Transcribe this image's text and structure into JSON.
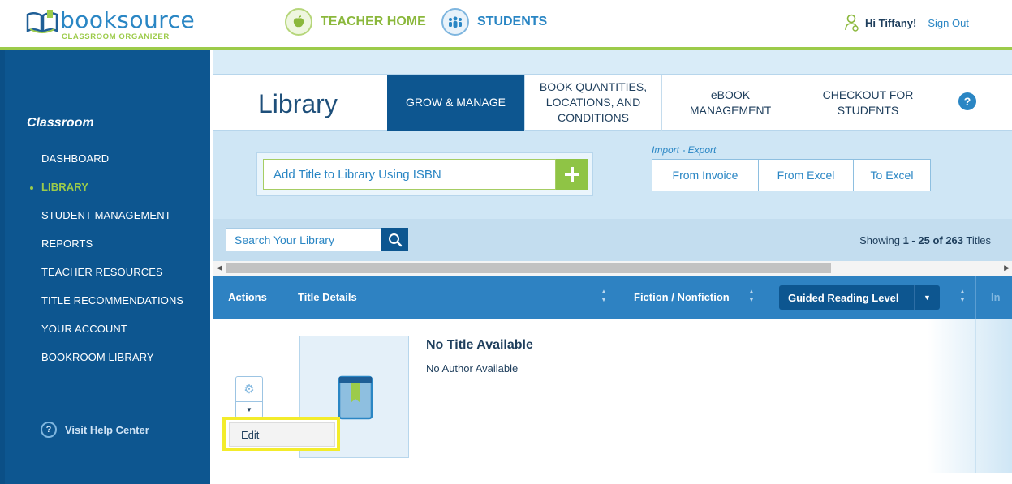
{
  "brand": {
    "name": "booksource",
    "tagline": "CLASSROOM ORGANIZER",
    "primary_color": "#2a86c4",
    "accent_color": "#9ccb4a",
    "sidebar_color": "#0d5690"
  },
  "header": {
    "nav": [
      {
        "label": "TEACHER HOME",
        "icon": "apple-icon",
        "active": true
      },
      {
        "label": "STUDENTS",
        "icon": "students-icon",
        "active": false
      }
    ],
    "greeting": "Hi Tiffany!",
    "sign_out": "Sign Out"
  },
  "sidebar": {
    "title": "Classroom",
    "items": [
      {
        "label": "DASHBOARD",
        "active": false
      },
      {
        "label": "LIBRARY",
        "active": true
      },
      {
        "label": "STUDENT MANAGEMENT",
        "active": false
      },
      {
        "label": "REPORTS",
        "active": false
      },
      {
        "label": "TEACHER RESOURCES",
        "active": false
      },
      {
        "label": "TITLE RECOMMENDATIONS",
        "active": false
      },
      {
        "label": "YOUR ACCOUNT",
        "active": false
      },
      {
        "label": "BOOKROOM LIBRARY",
        "active": false
      }
    ],
    "help": "Visit Help Center"
  },
  "library": {
    "title": "Library",
    "tabs": [
      {
        "label": "GROW & MANAGE",
        "selected": true
      },
      {
        "label": "BOOK QUANTITIES, LOCATIONS, AND CONDITIONS",
        "selected": false
      },
      {
        "label": "eBOOK MANAGEMENT",
        "selected": false
      },
      {
        "label": "CHECKOUT FOR STUDENTS",
        "selected": false
      }
    ],
    "help_glyph": "?",
    "isbn_placeholder": "Add Title to Library Using ISBN",
    "import_export_label": "Import - Export",
    "import_export_buttons": [
      "From Invoice",
      "From Excel",
      "To Excel"
    ],
    "search_placeholder": "Search Your Library",
    "showing": {
      "prefix": "Showing ",
      "range": "1 - 25 of 263",
      "suffix": " Titles"
    },
    "columns": [
      "Actions",
      "Title Details",
      "Fiction / Nonfiction",
      "Guided Reading Level",
      "In"
    ],
    "rows": [
      {
        "title": "No Title Available",
        "author": "No Author Available"
      }
    ],
    "action_menu": [
      "Edit"
    ]
  }
}
